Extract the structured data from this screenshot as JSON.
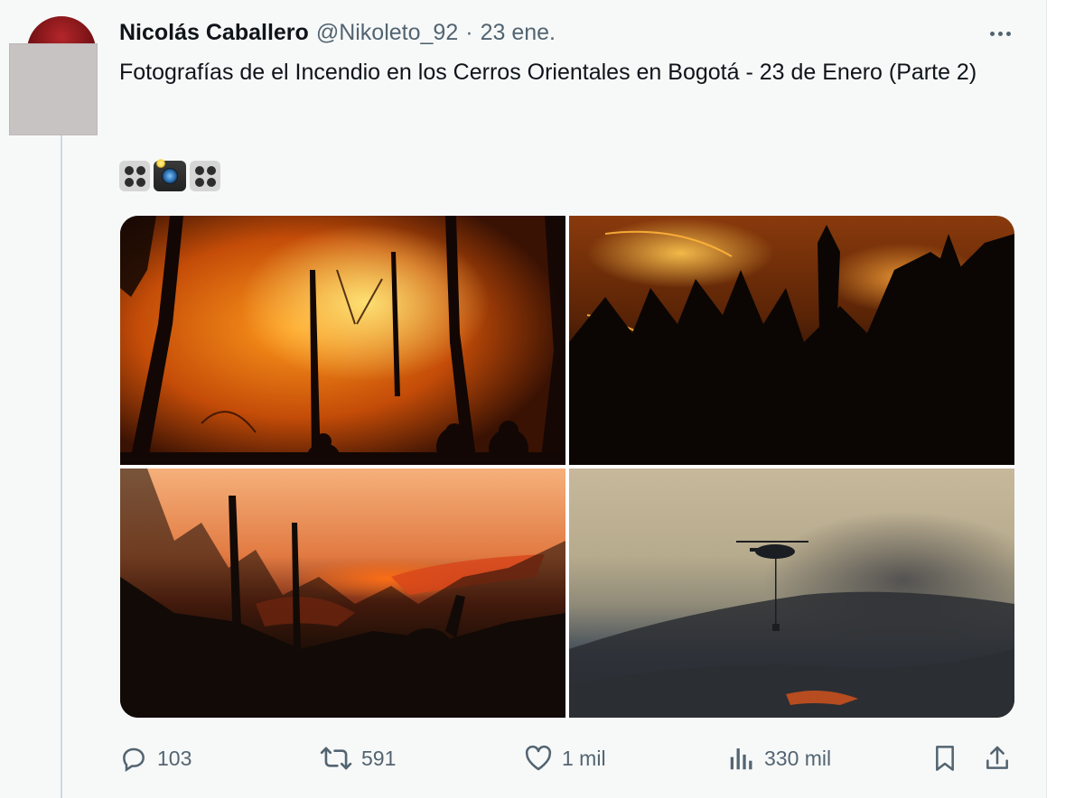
{
  "tweet": {
    "author_name": "Nicolás Caballero",
    "handle": "@Nikoleto_92",
    "separator": "·",
    "date": "23 ene.",
    "text": "Fotografías de el Incendio en los Cerros Orientales en Bogotá - 23 de Enero (Parte 2)",
    "emojis": [
      "film-reel-icon",
      "camera-flash-icon",
      "film-reel-icon"
    ]
  },
  "media": {
    "photos": [
      {
        "name": "forest-fire-firefighters-photo"
      },
      {
        "name": "burning-hillside-night-photo"
      },
      {
        "name": "deer-forest-fire-sunset-photo"
      },
      {
        "name": "helicopter-water-drop-photo"
      }
    ]
  },
  "actions": {
    "replies": "103",
    "retweets": "591",
    "likes": "1 mil",
    "views": "330 mil"
  },
  "colors": {
    "background": "#f7f9f9",
    "text": "#0f1419",
    "muted": "#536471",
    "thread_line": "#cfd9de"
  }
}
